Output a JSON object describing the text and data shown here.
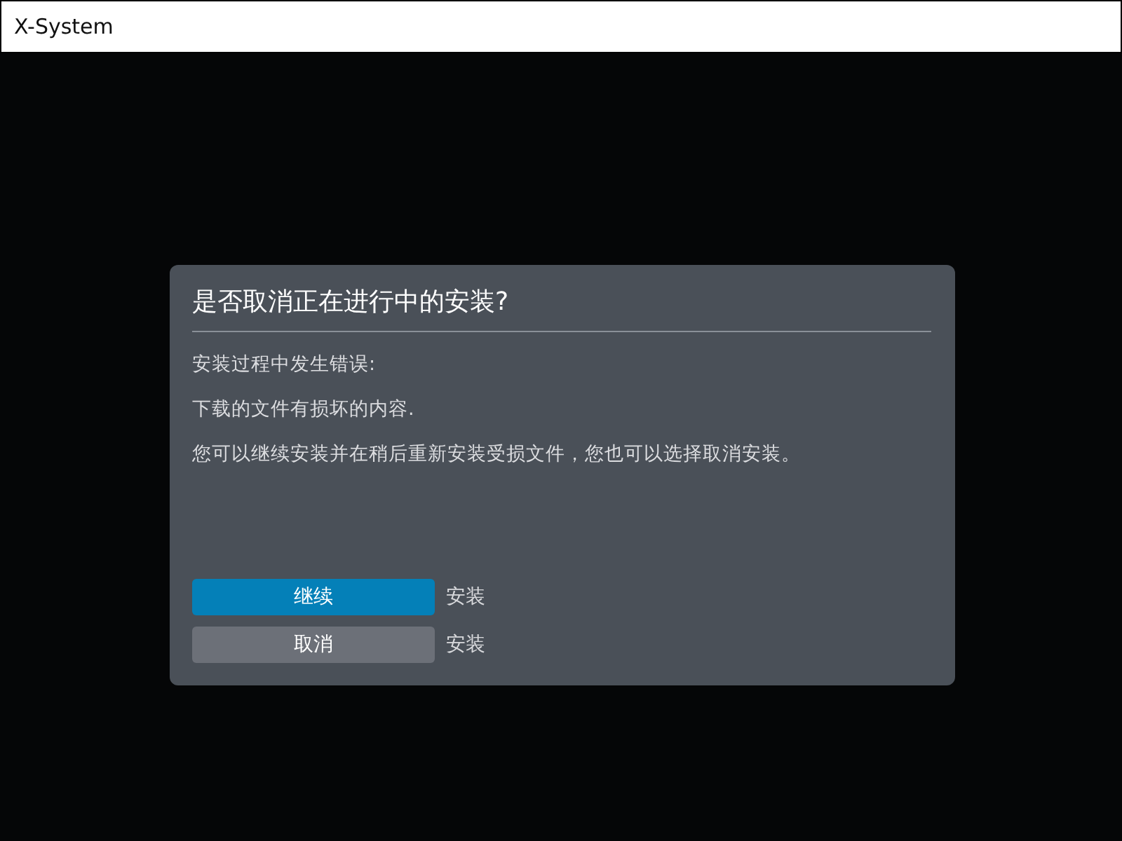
{
  "window": {
    "title": "X-System"
  },
  "dialog": {
    "title": "是否取消正在进行中的安装?",
    "paragraphs": [
      "安装过程中发生错误:",
      "下载的文件有损坏的内容.",
      "您可以继续安装并在稍后重新安装受损文件，您也可以选择取消安装。"
    ],
    "options": [
      {
        "button": "继续",
        "label": "安装",
        "selected": true
      },
      {
        "button": "取消",
        "label": "安装",
        "selected": false
      }
    ]
  }
}
